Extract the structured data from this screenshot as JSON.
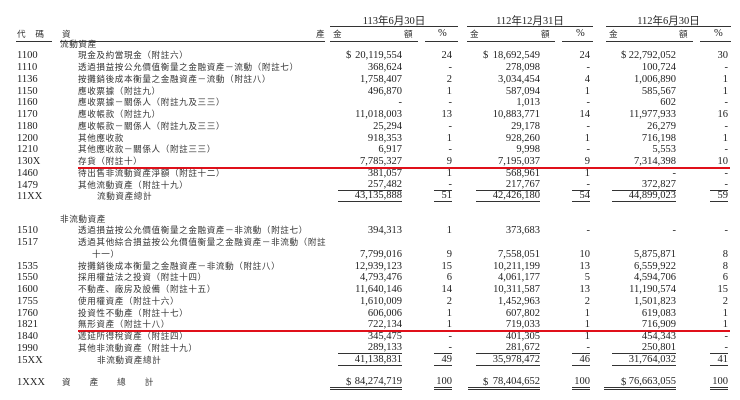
{
  "header": {
    "code_label": "代　碼",
    "asset_label_left": "資",
    "asset_label_right": "產",
    "periods": [
      {
        "date": "113年6月30日",
        "amount_label_left": "金",
        "amount_label_right": "額",
        "pct_label": "%"
      },
      {
        "date": "112年12月31日",
        "amount_label_left": "金",
        "amount_label_right": "額",
        "pct_label": "%"
      },
      {
        "date": "112年6月30日",
        "amount_label_left": "金",
        "amount_label_right": "額",
        "pct_label": "%"
      }
    ]
  },
  "currency_symbol": "$",
  "highlight_color": "#e0101a",
  "rows": [
    {
      "type": "section",
      "name": "流動資產"
    },
    {
      "code": "1100",
      "name": "現金及約當現金（附註六）",
      "vals": [
        "20,119,554",
        "24",
        "18,692,549",
        "24",
        "22,792,052",
        "30"
      ],
      "dollar": true
    },
    {
      "code": "1110",
      "name": "透過損益按公允價值衡量之金融資產－流動（附註七）",
      "vals": [
        "368,624",
        "-",
        "278,098",
        "-",
        "100,724",
        "-"
      ]
    },
    {
      "code": "1136",
      "name": "按攤銷後成本衡量之金融資產－流動（附註八）",
      "vals": [
        "1,758,407",
        "2",
        "3,034,454",
        "4",
        "1,006,890",
        "1"
      ]
    },
    {
      "code": "1150",
      "name": "應收票據（附註九）",
      "vals": [
        "496,870",
        "1",
        "587,094",
        "1",
        "585,567",
        "1"
      ]
    },
    {
      "code": "1160",
      "name": "應收票據－關係人（附註九及三三）",
      "vals": [
        "-",
        "-",
        "1,013",
        "-",
        "602",
        "-"
      ]
    },
    {
      "code": "1170",
      "name": "應收帳款（附註九）",
      "vals": [
        "11,018,003",
        "13",
        "10,883,771",
        "14",
        "11,977,933",
        "16"
      ]
    },
    {
      "code": "1180",
      "name": "應收帳款－關係人（附註九及三三）",
      "vals": [
        "25,294",
        "-",
        "29,178",
        "-",
        "26,279",
        "-"
      ]
    },
    {
      "code": "1200",
      "name": "其他應收款",
      "vals": [
        "918,353",
        "1",
        "928,260",
        "1",
        "716,198",
        "1"
      ]
    },
    {
      "code": "1210",
      "name": "其他應收款－關係人（附註三三）",
      "vals": [
        "6,917",
        "-",
        "9,998",
        "-",
        "5,553",
        "-"
      ]
    },
    {
      "code": "130X",
      "name": "存貨（附註十）",
      "vals": [
        "7,785,327",
        "9",
        "7,195,037",
        "9",
        "7,314,398",
        "10"
      ],
      "highlight": true
    },
    {
      "code": "1460",
      "name": "待出售非流動資產淨額（附註十二）",
      "vals": [
        "381,057",
        "1",
        "568,961",
        "1",
        "-",
        "-"
      ]
    },
    {
      "code": "1479",
      "name": "其他流動資產（附註十九）",
      "vals": [
        "257,482",
        "-",
        "217,767",
        "-",
        "372,827",
        "-"
      ],
      "underline": true
    },
    {
      "code": "11XX",
      "name": "流動資產總計",
      "vals": [
        "43,135,888",
        "51",
        "42,426,180",
        "54",
        "44,899,023",
        "59"
      ],
      "total": true,
      "underline": true
    },
    {
      "type": "gap"
    },
    {
      "type": "section",
      "name": "非流動資產"
    },
    {
      "code": "1510",
      "name": "透過損益按公允價值衡量之金融資產－非流動（附註七）",
      "vals": [
        "394,313",
        "1",
        "373,683",
        "-",
        "-",
        "-"
      ]
    },
    {
      "code": "1517",
      "name": "透過其他綜合損益按公允價值衡量之金融資產－非流動（附註",
      "vals": null
    },
    {
      "code": "",
      "name": "十一）",
      "vals": [
        "7,799,016",
        "9",
        "7,558,051",
        "10",
        "5,875,871",
        "8"
      ],
      "cont": true
    },
    {
      "code": "1535",
      "name": "按攤銷後成本衡量之金融資產－非流動（附註八）",
      "vals": [
        "12,939,123",
        "15",
        "10,211,199",
        "13",
        "6,559,922",
        "8"
      ]
    },
    {
      "code": "1550",
      "name": "採用權益法之投資（附註十四）",
      "vals": [
        "4,793,476",
        "6",
        "4,061,177",
        "5",
        "4,594,706",
        "6"
      ]
    },
    {
      "code": "1600",
      "name": "不動產、廠房及設備（附註十五）",
      "vals": [
        "11,640,146",
        "14",
        "10,311,587",
        "13",
        "11,190,574",
        "15"
      ]
    },
    {
      "code": "1755",
      "name": "使用權資產（附註十六）",
      "vals": [
        "1,610,009",
        "2",
        "1,452,963",
        "2",
        "1,501,823",
        "2"
      ]
    },
    {
      "code": "1760",
      "name": "投資性不動產（附註十七）",
      "vals": [
        "606,006",
        "1",
        "607,802",
        "1",
        "619,083",
        "1"
      ]
    },
    {
      "code": "1821",
      "name": "無形資產（附註十八）",
      "vals": [
        "722,134",
        "1",
        "719,033",
        "1",
        "716,909",
        "1"
      ],
      "highlight": true
    },
    {
      "code": "1840",
      "name": "遞延所得稅資產（附註四）",
      "vals": [
        "345,475",
        "-",
        "401,305",
        "1",
        "454,343",
        "-"
      ]
    },
    {
      "code": "1990",
      "name": "其他非流動資產（附註十九）",
      "vals": [
        "289,133",
        "-",
        "281,672",
        "-",
        "250,801",
        "-"
      ],
      "underline": true
    },
    {
      "code": "15XX",
      "name": "非流動資產總計",
      "vals": [
        "41,138,831",
        "49",
        "35,978,472",
        "46",
        "31,764,032",
        "41"
      ],
      "total": true,
      "underline": true
    },
    {
      "type": "gap"
    },
    {
      "code": "1XXX",
      "name": "資　　產　　總　　計",
      "vals": [
        "84,274,719",
        "100",
        "78,404,652",
        "100",
        "76,663,055",
        "100"
      ],
      "grand": true,
      "dollar": true
    }
  ]
}
